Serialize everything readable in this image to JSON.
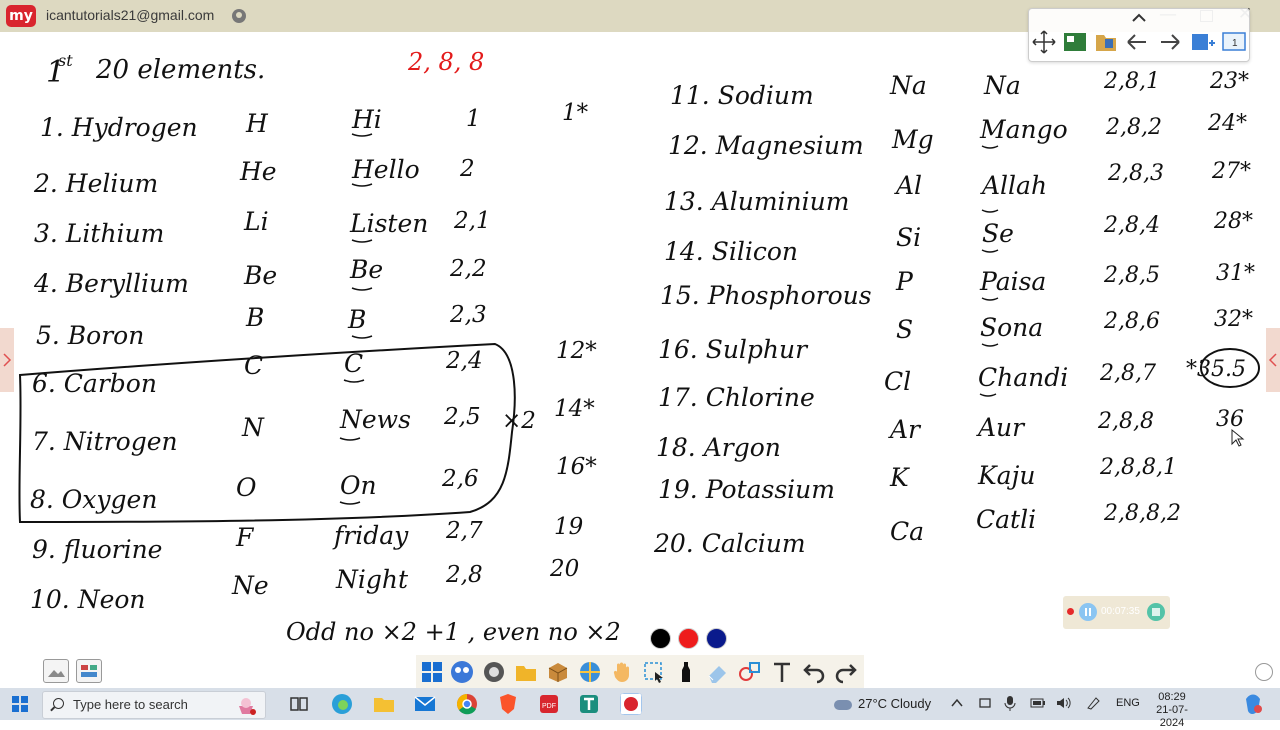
{
  "app": {
    "logo_text": "my",
    "account_email": "icantutorials21@gmail.com",
    "window_controls": {
      "minimize": "—",
      "close": "✕"
    }
  },
  "board": {
    "title": {
      "ordinal": "1",
      "superscript": "st",
      "text": "20 elements.",
      "pattern": "2, 8, 8"
    },
    "left_rows": [
      {
        "name": "1. Hydrogen",
        "symbol": "H",
        "mnemonic": "Hi",
        "config": "1",
        "mass": "1*"
      },
      {
        "name": "2. Helium",
        "symbol": "He",
        "mnemonic": "Hello",
        "config": "2",
        "mass": ""
      },
      {
        "name": "3. Lithium",
        "symbol": "Li",
        "mnemonic": "Listen",
        "config": "2,1",
        "mass": ""
      },
      {
        "name": "4. Beryllium",
        "symbol": "Be",
        "mnemonic": "Be",
        "config": "2,2",
        "mass": ""
      },
      {
        "name": "5. Boron",
        "symbol": "B",
        "mnemonic": "B",
        "config": "2,3",
        "mass": ""
      },
      {
        "name": "6. Carbon",
        "symbol": "C",
        "mnemonic": "C",
        "config": "2,4",
        "mass": "12*"
      },
      {
        "name": "7. Nitrogen",
        "symbol": "N",
        "mnemonic": "News",
        "config": "2,5",
        "mass": "14*"
      },
      {
        "name": "8. Oxygen",
        "symbol": "O",
        "mnemonic": "On",
        "config": "2,6",
        "mass": "16*"
      },
      {
        "name": "9. fluorine",
        "symbol": "F",
        "mnemonic": "friday",
        "config": "2,7",
        "mass": "19"
      },
      {
        "name": "10. Neon",
        "symbol": "Ne",
        "mnemonic": "Night",
        "config": "2,8",
        "mass": "20"
      }
    ],
    "box_note": "×2",
    "right_rows": [
      {
        "name": "11. Sodium",
        "symbol": "Na",
        "mnemonic": "Na",
        "config": "2,8,1",
        "mass": "23*"
      },
      {
        "name": "12. Magnesium",
        "symbol": "Mg",
        "mnemonic": "Mango",
        "config": "2,8,2",
        "mass": "24*"
      },
      {
        "name": "13. Aluminium",
        "symbol": "Al",
        "mnemonic": "Allah",
        "config": "2,8,3",
        "mass": "27*"
      },
      {
        "name": "14. Silicon",
        "symbol": "Si",
        "mnemonic": "Se",
        "config": "2,8,4",
        "mass": "28*"
      },
      {
        "name": "15. Phosphorous",
        "symbol": "P",
        "mnemonic": "Paisa",
        "config": "2,8,5",
        "mass": "31*"
      },
      {
        "name": "16. Sulphur",
        "symbol": "S",
        "mnemonic": "Sona",
        "config": "2,8,6",
        "mass": "32*"
      },
      {
        "name": "17. Chlorine",
        "symbol": "Cl",
        "mnemonic": "Chandi",
        "config": "2,8,7",
        "mass": "*35.5"
      },
      {
        "name": "18. Argon",
        "symbol": "Ar",
        "mnemonic": "Aur",
        "config": "2,8,8",
        "mass": "36"
      },
      {
        "name": "19. Potassium",
        "symbol": "K",
        "mnemonic": "Kaju",
        "config": "2,8,8,1",
        "mass": ""
      },
      {
        "name": "20. Calcium",
        "symbol": "Ca",
        "mnemonic": "Catli",
        "config": "2,8,8,2",
        "mass": ""
      }
    ],
    "footer_rule": "Odd no ×2 +1 , even no ×2"
  },
  "palette": {
    "colors": [
      "#000000",
      "#ee1c1c",
      "#0a1a8c"
    ]
  },
  "recorder": {
    "time": "00:07:35",
    "dot_color": "#e52a2a"
  },
  "taskbar": {
    "search_placeholder": "Type here to search",
    "weather": "27°C Cloudy",
    "language": "ENG",
    "time": "08:29",
    "date": "21-07-2024"
  }
}
